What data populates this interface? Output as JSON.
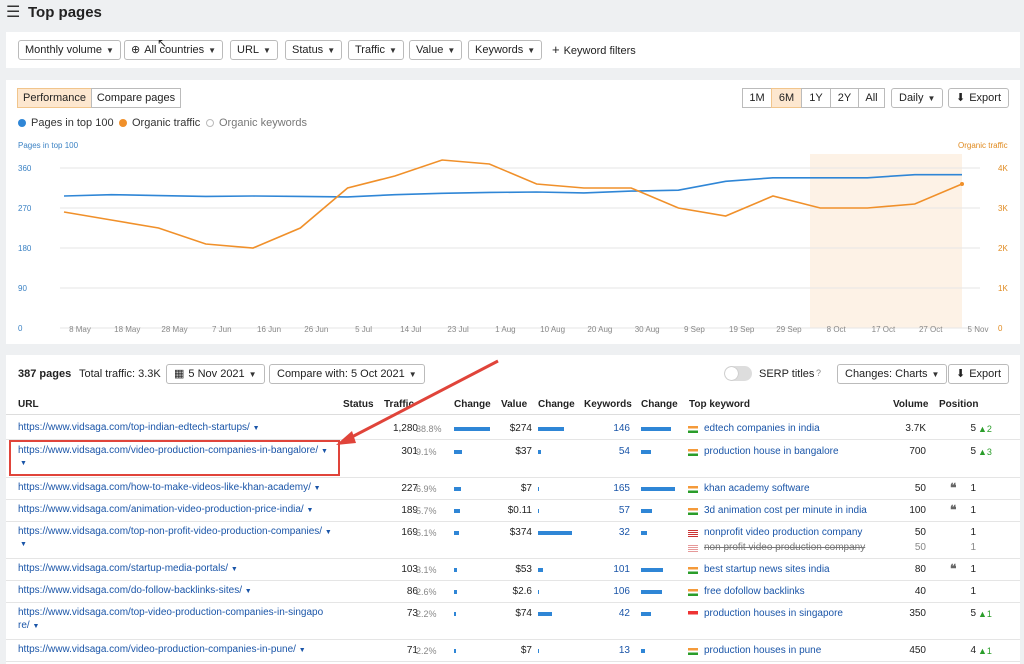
{
  "header": {
    "title": "Top pages"
  },
  "filters": [
    "Monthly volume",
    "All countries",
    "URL",
    "Status",
    "Traffic",
    "Value",
    "Keywords"
  ],
  "keyword_filters": "Keyword filters",
  "chart": {
    "tabs": [
      "Performance",
      "Compare pages"
    ],
    "ranges": [
      "1M",
      "6M",
      "1Y",
      "2Y",
      "All"
    ],
    "interval": "Daily",
    "export": "Export",
    "legend": [
      "Pages in top 100",
      "Organic traffic",
      "Organic keywords"
    ],
    "left_axis_title": "Pages in top 100",
    "right_axis_title": "Organic traffic",
    "yleft": [
      "360",
      "270",
      "180",
      "90",
      "0"
    ],
    "yright": [
      "4K",
      "3K",
      "2K",
      "1K",
      "0"
    ],
    "xticks": [
      "8 May",
      "18 May",
      "28 May",
      "7 Jun",
      "16 Jun",
      "26 Jun",
      "5 Jul",
      "14 Jul",
      "23 Jul",
      "1 Aug",
      "10 Aug",
      "20 Aug",
      "30 Aug",
      "9 Sep",
      "19 Sep",
      "29 Sep",
      "8 Oct",
      "17 Oct",
      "27 Oct",
      "5 Nov"
    ],
    "colors": {
      "pages": "#2f86d6",
      "traffic": "#f0902a"
    }
  },
  "chart_data": {
    "type": "line",
    "x": [
      "8 May",
      "18 May",
      "28 May",
      "7 Jun",
      "16 Jun",
      "26 Jun",
      "5 Jul",
      "14 Jul",
      "23 Jul",
      "1 Aug",
      "10 Aug",
      "20 Aug",
      "30 Aug",
      "9 Sep",
      "19 Sep",
      "29 Sep",
      "8 Oct",
      "17 Oct",
      "27 Oct",
      "5 Nov"
    ],
    "series": [
      {
        "name": "Pages in top 100",
        "axis": "left",
        "values": [
          297,
          300,
          298,
          296,
          297,
          296,
          295,
          300,
          303,
          305,
          306,
          304,
          308,
          310,
          330,
          338,
          338,
          338,
          345,
          345
        ]
      },
      {
        "name": "Organic traffic",
        "axis": "right",
        "values": [
          2900,
          2700,
          2500,
          2100,
          2000,
          2500,
          3500,
          3800,
          4200,
          4100,
          3600,
          3500,
          3500,
          3000,
          2800,
          3300,
          3000,
          3000,
          3100,
          3600
        ]
      }
    ],
    "ylim_left": [
      0,
      360
    ],
    "ylim_right": [
      0,
      4000
    ]
  },
  "table": {
    "summary": "387 pages",
    "total_traffic": "Total traffic: 3.3K",
    "date": "5 Nov 2021",
    "compare": "Compare with: 5 Oct 2021",
    "serp_titles": "SERP titles",
    "changes": "Changes: Charts",
    "export": "Export",
    "headers": [
      "URL",
      "Status",
      "Traffic",
      "Change",
      "Value",
      "Change",
      "Keywords",
      "Change",
      "Top keyword",
      "Volume",
      "Position"
    ],
    "rows": [
      {
        "url": "https://www.vidsaga.com/top-indian-edtech-startups/",
        "traffic": "1,280",
        "pct": "38.8%",
        "value": "$274",
        "keywords": "146",
        "kw": "edtech companies in india",
        "volume": "3.7K",
        "pos": "5",
        "delta": "▲2"
      },
      {
        "url": "https://www.vidsaga.com/video-production-companies-in-bangalore/",
        "traffic": "301",
        "pct": "9.1%",
        "value": "$37",
        "keywords": "54",
        "kw": "production house in bangalore",
        "volume": "700",
        "pos": "5",
        "delta": "▲3"
      },
      {
        "url": "https://www.vidsaga.com/how-to-make-videos-like-khan-academy/",
        "traffic": "227",
        "pct": "6.9%",
        "value": "$7",
        "keywords": "165",
        "kw": "khan academy software",
        "volume": "50",
        "pos": "1",
        "delta": ""
      },
      {
        "url": "https://www.vidsaga.com/animation-video-production-price-india/",
        "traffic": "189",
        "pct": "5.7%",
        "value": "$0.11",
        "keywords": "57",
        "kw": "3d animation cost per minute in india",
        "volume": "100",
        "pos": "1",
        "delta": ""
      },
      {
        "url": "https://www.vidsaga.com/top-non-profit-video-production-companies/",
        "traffic": "169",
        "pct": "5.1%",
        "value": "$374",
        "keywords": "32",
        "kw": "nonprofit video production company",
        "kw2": "non profit video production company",
        "volume": "50",
        "volume2": "50",
        "pos": "1",
        "pos2": "1",
        "delta": ""
      },
      {
        "url": "https://www.vidsaga.com/startup-media-portals/",
        "traffic": "103",
        "pct": "3.1%",
        "value": "$53",
        "keywords": "101",
        "kw": "best startup news sites india",
        "volume": "80",
        "pos": "1",
        "delta": ""
      },
      {
        "url": "https://www.vidsaga.com/do-follow-backlinks-sites/",
        "traffic": "86",
        "pct": "2.6%",
        "value": "$2.6",
        "keywords": "106",
        "kw": "free dofollow backlinks",
        "volume": "40",
        "pos": "1",
        "delta": ""
      },
      {
        "url": "https://www.vidsaga.com/top-video-production-companies-in-singapo",
        "url2": "re/",
        "traffic": "73",
        "pct": "2.2%",
        "value": "$74",
        "keywords": "42",
        "kw": "production houses in singapore",
        "volume": "350",
        "pos": "5",
        "delta": "▲1"
      },
      {
        "url": "https://www.vidsaga.com/video-production-companies-in-pune/",
        "traffic": "71",
        "pct": "2.2%",
        "value": "$7",
        "keywords": "13",
        "kw": "production houses in pune",
        "volume": "450",
        "pos": "4",
        "delta": "▲1"
      }
    ]
  }
}
